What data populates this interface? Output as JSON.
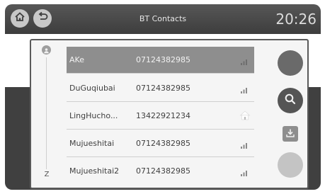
{
  "header": {
    "title": "BT Contacts",
    "clock": "20:26",
    "home_icon": "home-icon",
    "back_icon": "back-icon"
  },
  "index": {
    "top_icon": "user-icon",
    "bottom_letter": "Z"
  },
  "contacts": [
    {
      "name": "AKe",
      "number": "07124382985",
      "icon": "signal-icon",
      "selected": true
    },
    {
      "name": "DuGuqiubai",
      "number": "07124382985",
      "icon": "signal-icon",
      "selected": false
    },
    {
      "name": "LingHucho...",
      "number": "13422921234",
      "icon": "home-icon",
      "selected": false
    },
    {
      "name": "Mujueshitai",
      "number": "07124382985",
      "icon": "signal-icon",
      "selected": false
    },
    {
      "name": "Mujueshitai2",
      "number": "07124382985",
      "icon": "signal-icon",
      "selected": false
    }
  ],
  "side_actions": [
    {
      "icon": "call-icon"
    },
    {
      "icon": "search-icon"
    },
    {
      "icon": "download-icon"
    },
    {
      "icon": "delete-icon"
    }
  ],
  "colors": {
    "topbar": "#4a4a4a",
    "selected_row": "#8e8e8e",
    "call_button": "#6a6a6a",
    "search_button": "#555555",
    "disabled_button": "#c4c4c4"
  }
}
